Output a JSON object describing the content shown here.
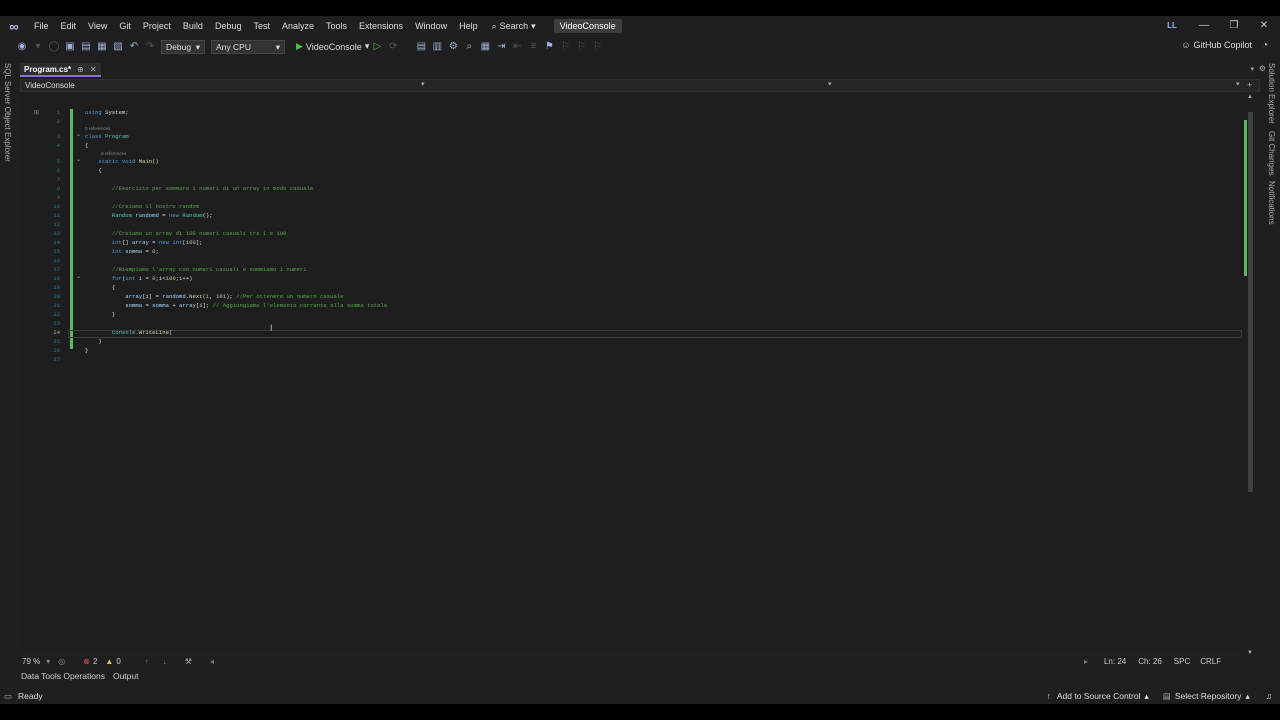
{
  "menu": {
    "items": [
      "File",
      "Edit",
      "View",
      "Git",
      "Project",
      "Build",
      "Debug",
      "Test",
      "Analyze",
      "Tools",
      "Extensions",
      "Window",
      "Help"
    ],
    "search_label": "Search",
    "solution_title": "VideoConsole",
    "avatar_initials": "LL"
  },
  "toolbar": {
    "configuration": "Debug",
    "platform": "Any CPU",
    "run_target": "VideoConsole",
    "copilot_label": "GitHub Copilot"
  },
  "left_rail": {
    "label": "SQL Server Object Explorer"
  },
  "right_rail": {
    "items": [
      "Solution Explorer",
      "Git Changes",
      "Notifications"
    ]
  },
  "editor_tab": {
    "name": "Program.cs*"
  },
  "navbar": {
    "scope": "VideoConsole"
  },
  "code": {
    "references_0a": "0 references",
    "references_0b": "0 references",
    "lines": [
      {
        "n": "1",
        "segs": [
          [
            "kw",
            "using "
          ],
          [
            "",
            "System;"
          ]
        ]
      },
      {
        "n": "2",
        "segs": []
      },
      {
        "n": "3",
        "segs": [
          [
            "kw",
            "class "
          ],
          [
            "ty",
            "Program"
          ]
        ]
      },
      {
        "n": "4",
        "segs": [
          [
            "",
            "{"
          ]
        ]
      },
      {
        "n": "5",
        "segs": [
          [
            "",
            "    "
          ],
          [
            "kw",
            "static void "
          ],
          [
            "fn",
            "Main"
          ],
          [
            "",
            "()"
          ]
        ]
      },
      {
        "n": "6",
        "segs": [
          [
            "",
            "    {"
          ]
        ]
      },
      {
        "n": "7",
        "segs": []
      },
      {
        "n": "8",
        "segs": [
          [
            "",
            "        "
          ],
          [
            "cmt",
            "//Esercizio per sommare i numeri di un array in modo casuale"
          ]
        ]
      },
      {
        "n": "9",
        "segs": []
      },
      {
        "n": "10",
        "segs": [
          [
            "",
            "        "
          ],
          [
            "cmt",
            "//Creiamo il nostro random"
          ]
        ]
      },
      {
        "n": "11",
        "segs": [
          [
            "",
            "        "
          ],
          [
            "ty",
            "Random "
          ],
          [
            "var",
            "randomd"
          ],
          [
            "",
            " = "
          ],
          [
            "kw",
            "new "
          ],
          [
            "ty",
            "Random"
          ],
          [
            "",
            "();"
          ]
        ]
      },
      {
        "n": "12",
        "segs": []
      },
      {
        "n": "13",
        "segs": [
          [
            "",
            "        "
          ],
          [
            "cmt",
            "//Creiamo un array di 100 numeri casuali tra 1 e 100"
          ]
        ]
      },
      {
        "n": "14",
        "segs": [
          [
            "",
            "        "
          ],
          [
            "kw",
            "int"
          ],
          [
            "",
            "[] "
          ],
          [
            "var",
            "array"
          ],
          [
            "",
            " = "
          ],
          [
            "kw",
            "new int"
          ],
          [
            "",
            "["
          ],
          [
            "num",
            "100"
          ],
          [
            "",
            "];"
          ]
        ]
      },
      {
        "n": "15",
        "segs": [
          [
            "",
            "        "
          ],
          [
            "kw",
            "int "
          ],
          [
            "var",
            "somma"
          ],
          [
            "",
            " = "
          ],
          [
            "num",
            "0"
          ],
          [
            "",
            ";"
          ]
        ]
      },
      {
        "n": "16",
        "segs": []
      },
      {
        "n": "17",
        "segs": [
          [
            "",
            "        "
          ],
          [
            "cmt",
            "//Riempiamo l'array con numeri casuali e sommiamo i numeri"
          ]
        ]
      },
      {
        "n": "18",
        "segs": [
          [
            "",
            "        "
          ],
          [
            "kw",
            "for"
          ],
          [
            "",
            "("
          ],
          [
            "kw",
            "int "
          ],
          [
            "var",
            "i"
          ],
          [
            "",
            " = "
          ],
          [
            "num",
            "0"
          ],
          [
            "",
            ";i<"
          ],
          [
            "num",
            "100"
          ],
          [
            "",
            ";i++)"
          ]
        ]
      },
      {
        "n": "19",
        "segs": [
          [
            "",
            "        {"
          ]
        ]
      },
      {
        "n": "20",
        "segs": [
          [
            "",
            "            "
          ],
          [
            "var",
            "array"
          ],
          [
            "",
            "[i] = "
          ],
          [
            "var",
            "randomd"
          ],
          [
            "",
            "."
          ],
          [
            "fn",
            "Next"
          ],
          [
            "",
            "("
          ],
          [
            "num",
            "1"
          ],
          [
            "",
            ", "
          ],
          [
            "num",
            "101"
          ],
          [
            "",
            "); "
          ],
          [
            "cmt",
            "//Per ottenere un numero casuale"
          ]
        ]
      },
      {
        "n": "21",
        "segs": [
          [
            "",
            "            "
          ],
          [
            "var",
            "somma"
          ],
          [
            "",
            " = "
          ],
          [
            "var",
            "somma"
          ],
          [
            "",
            " + "
          ],
          [
            "var",
            "array"
          ],
          [
            "",
            "[i]; "
          ],
          [
            "cmt",
            "// Aggiungiamo l'elemento corrente alla somma totale"
          ]
        ]
      },
      {
        "n": "22",
        "segs": [
          [
            "",
            "        }"
          ]
        ]
      },
      {
        "n": "23",
        "segs": []
      },
      {
        "n": "24",
        "segs": [
          [
            "",
            "        "
          ],
          [
            "ty",
            "Console"
          ],
          [
            "",
            "."
          ],
          [
            "fn",
            "WriteLine"
          ],
          [
            "",
            "("
          ]
        ]
      },
      {
        "n": "25",
        "segs": [
          [
            "",
            "    }"
          ]
        ]
      },
      {
        "n": "26",
        "segs": [
          [
            "",
            "}"
          ]
        ]
      },
      {
        "n": "27",
        "segs": []
      }
    ],
    "current_line": "24"
  },
  "status_row": {
    "zoom": "79 %",
    "errors": "2",
    "warnings": "0",
    "line": "Ln: 24",
    "col": "Ch: 26",
    "whitespace": "SPC",
    "line_endings": "CRLF"
  },
  "panel_tabs": [
    "Data Tools Operations",
    "Output"
  ],
  "statusbar": {
    "ready": "Ready",
    "add_source": "Add to Source Control",
    "select_repo": "Select Repository"
  },
  "colors": {
    "accent": "#8a6fd8",
    "run": "#4cc24c",
    "error": "#e05252",
    "change_bar": "#5cb85c"
  }
}
